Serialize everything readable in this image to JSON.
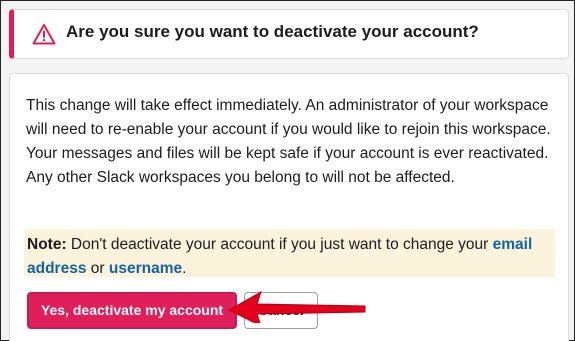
{
  "header": {
    "title": "Are you sure you want to deactivate your account?",
    "icon": "warning-triangle-icon"
  },
  "body": {
    "message": "This change will take effect immediately. An administrator of your workspace will need to re-enable your account if you would like to rejoin this workspace. Your messages and files will be kept safe if your account is ever reactivated. Any other Slack workspaces you belong to will not be affected."
  },
  "note": {
    "label": "Note:",
    "text_before": " Don't deactivate your account if you just want to change your ",
    "link_email": "email address",
    "text_middle": " or ",
    "link_username": "username",
    "text_after": "."
  },
  "actions": {
    "deactivate_label": "Yes, deactivate my account",
    "cancel_label": "Cancel"
  },
  "colors": {
    "accent": "#e01e5a",
    "link": "#1264a3",
    "note_background": "#fbf3db",
    "annotation_arrow": "#e3001b"
  }
}
